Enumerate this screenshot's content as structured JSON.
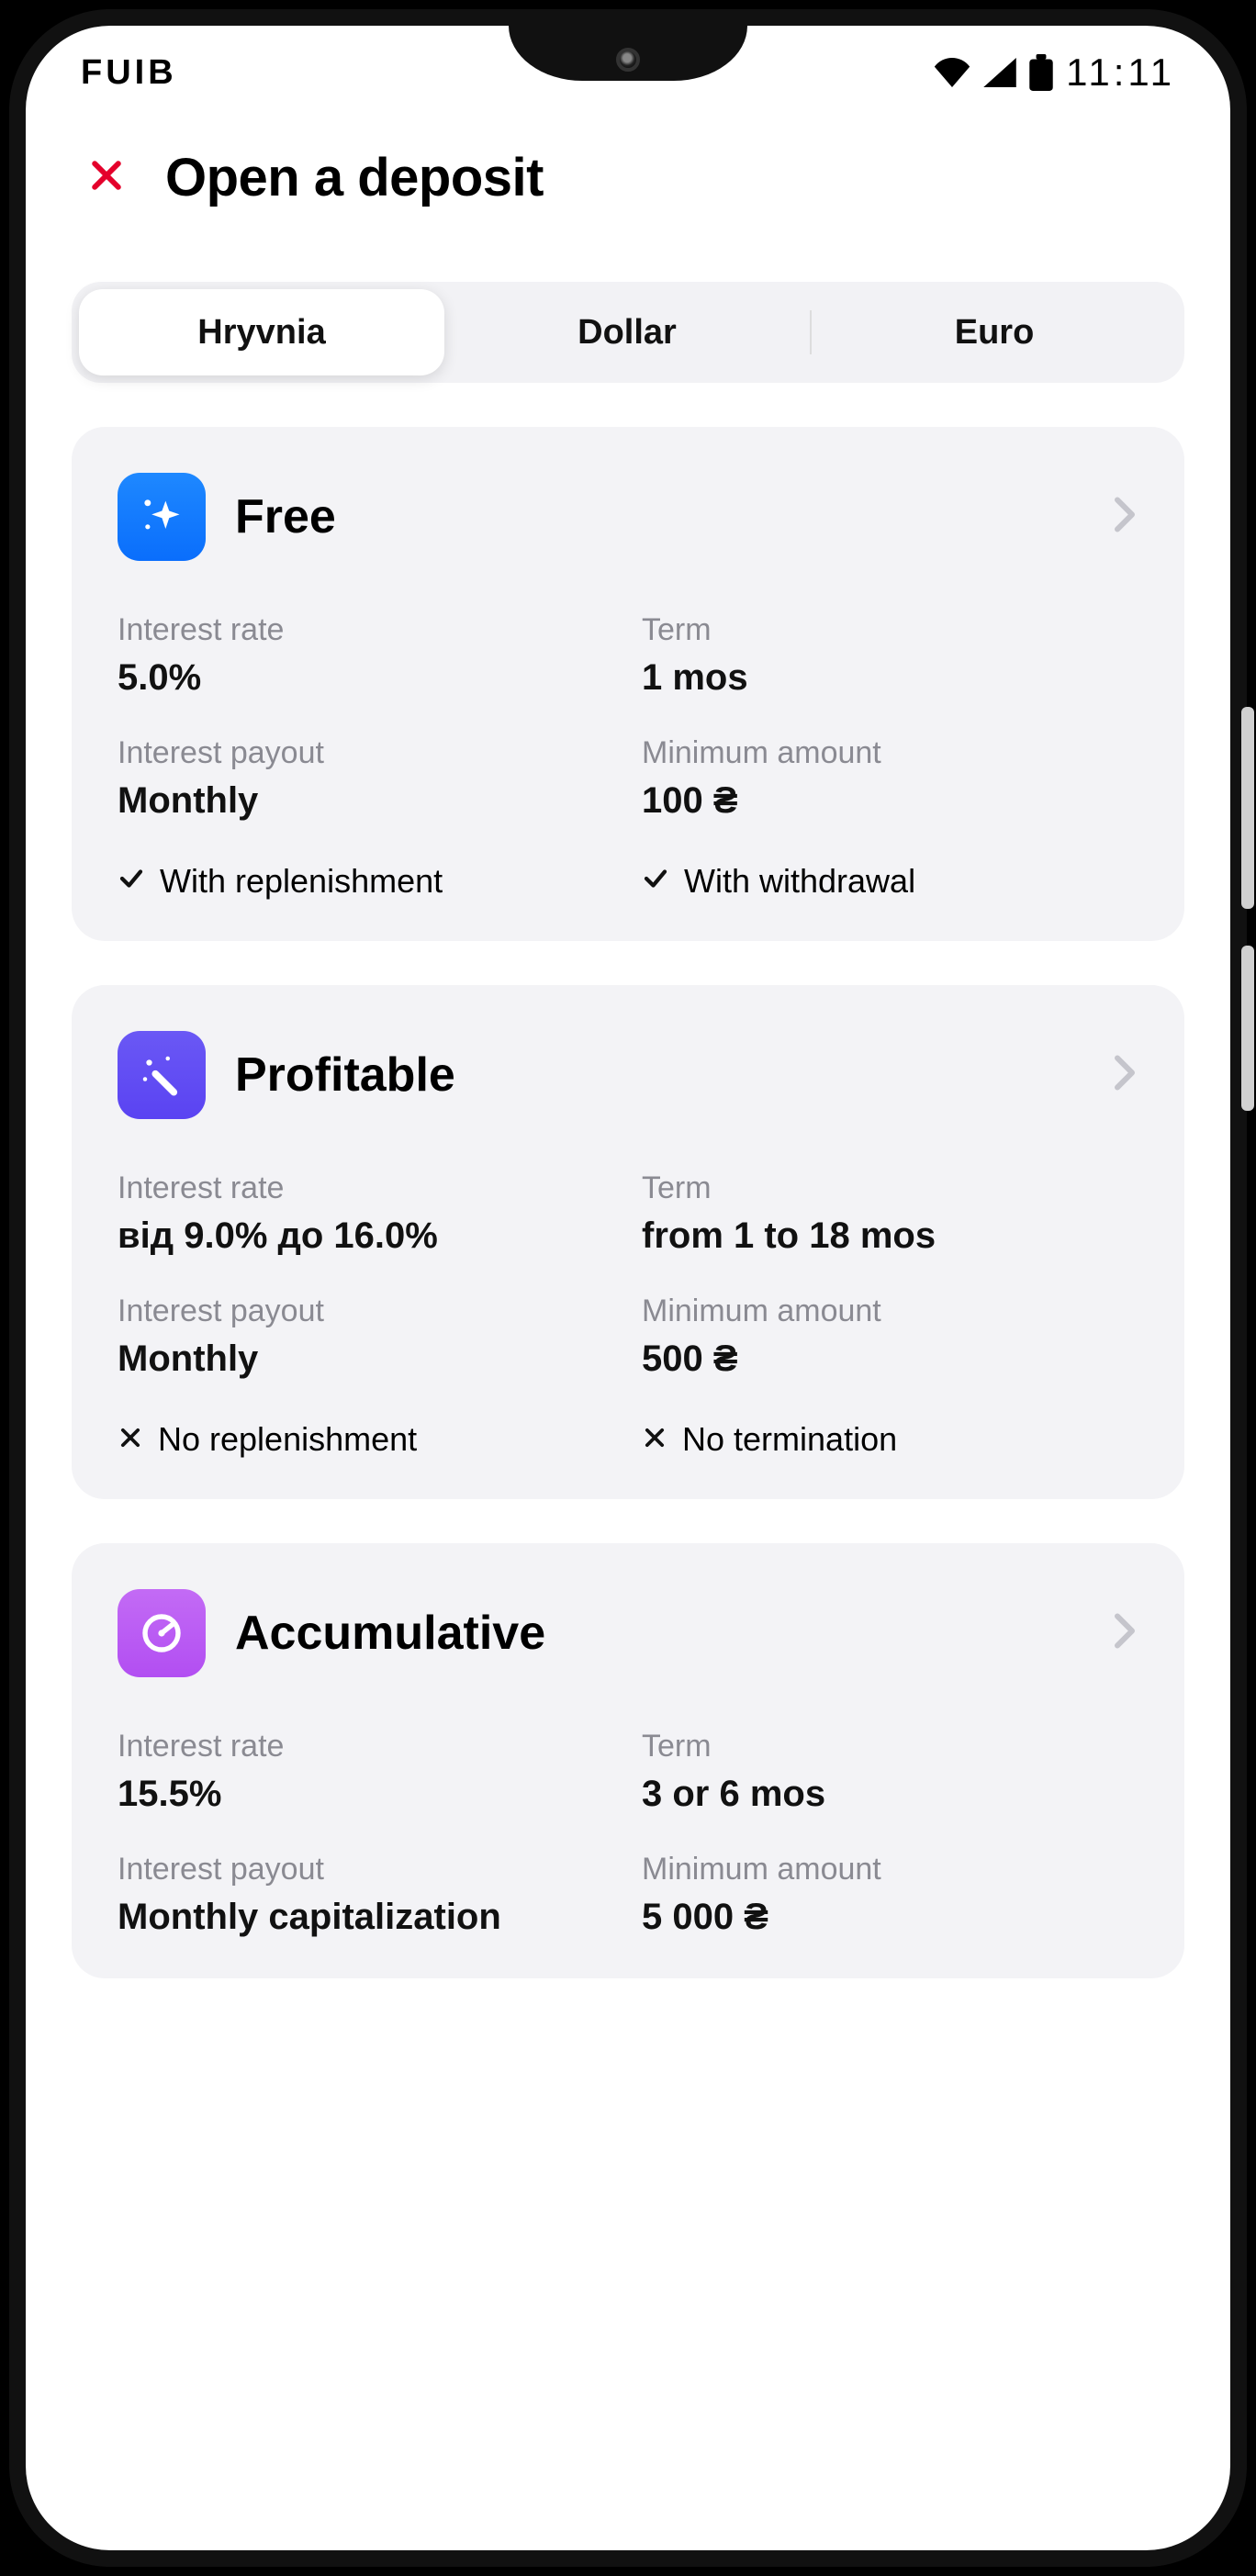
{
  "status": {
    "carrier": "FUIB",
    "time": "11:11"
  },
  "header": {
    "title": "Open a deposit"
  },
  "tabs": {
    "items": [
      {
        "label": "Hryvnia",
        "active": true
      },
      {
        "label": "Dollar",
        "active": false
      },
      {
        "label": "Euro",
        "active": false
      }
    ]
  },
  "labels": {
    "interest_rate": "Interest rate",
    "term": "Term",
    "interest_payout": "Interest payout",
    "minimum_amount": "Minimum amount"
  },
  "deposits": [
    {
      "name": "Free",
      "icon": "sparkle-icon",
      "icon_class": "ic-free",
      "interest_rate": "5.0%",
      "term": "1 mos",
      "interest_payout": "Monthly",
      "minimum_amount": "100 ₴",
      "features": [
        {
          "ok": true,
          "text": "With replenishment"
        },
        {
          "ok": true,
          "text": "With withdrawal"
        }
      ]
    },
    {
      "name": "Profitable",
      "icon": "wand-sparkle-icon",
      "icon_class": "ic-prof",
      "interest_rate": "від 9.0% до 16.0%",
      "term": "from 1 to 18 mos",
      "interest_payout": "Monthly",
      "minimum_amount": "500 ₴",
      "features": [
        {
          "ok": false,
          "text": "No replenishment"
        },
        {
          "ok": false,
          "text": "No termination"
        }
      ]
    },
    {
      "name": "Accumulative",
      "icon": "gauge-icon",
      "icon_class": "ic-acc",
      "interest_rate": "15.5%",
      "term": "3 or 6 mos",
      "interest_payout": "Monthly capitalization",
      "minimum_amount": "5 000 ₴",
      "features": []
    }
  ]
}
